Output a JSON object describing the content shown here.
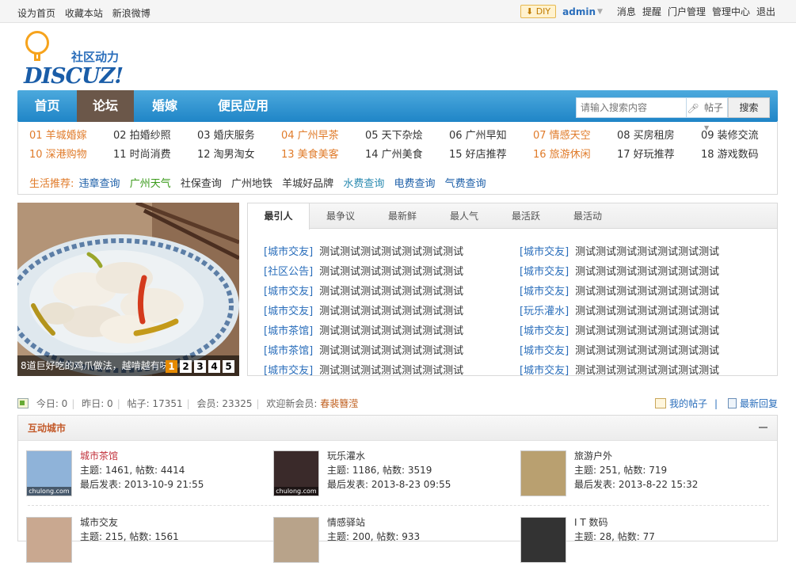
{
  "topbar": {
    "left": [
      "设为首页",
      "收藏本站",
      "新浪微博"
    ],
    "diy": "DIY",
    "user": "admin",
    "right": [
      "消息",
      "提醒",
      "门户管理",
      "管理中心",
      "退出"
    ]
  },
  "logo": {
    "tagline": "社区动力",
    "wordmark": "DISCUZ!"
  },
  "nav": {
    "items": [
      {
        "label": "首页",
        "active": false
      },
      {
        "label": "论坛",
        "active": true
      },
      {
        "label": "婚嫁",
        "active": false
      },
      {
        "label": "便民应用",
        "active": false
      }
    ],
    "search": {
      "placeholder": "请输入搜索内容",
      "type": "帖子",
      "button": "搜索"
    }
  },
  "categories": {
    "row1": [
      {
        "label": "01 羊城婚嫁",
        "highlight": true
      },
      {
        "label": "02 拍婚纱照",
        "highlight": false
      },
      {
        "label": "03 婚庆服务",
        "highlight": false
      },
      {
        "label": "04 广州早茶",
        "highlight": true
      },
      {
        "label": "05 天下杂烩",
        "highlight": false
      },
      {
        "label": "06 广州早知",
        "highlight": false
      },
      {
        "label": "07 情感天空",
        "highlight": true
      },
      {
        "label": "08 买房租房",
        "highlight": false
      },
      {
        "label": "09 装修交流",
        "highlight": false
      }
    ],
    "row2": [
      {
        "label": "10 深港购物",
        "highlight": true
      },
      {
        "label": "11 时尚消费",
        "highlight": false
      },
      {
        "label": "12 淘男淘女",
        "highlight": false
      },
      {
        "label": "13 美食美客",
        "highlight": true
      },
      {
        "label": "14 广州美食",
        "highlight": false
      },
      {
        "label": "15 好店推荐",
        "highlight": false
      },
      {
        "label": "16 旅游休闲",
        "highlight": true
      },
      {
        "label": "17 好玩推荐",
        "highlight": false
      },
      {
        "label": "18 游戏数码",
        "highlight": false
      }
    ],
    "life": {
      "label": "生活推荐:",
      "items": [
        "违章查询",
        "广州天气",
        "社保查询",
        "广州地铁",
        "羊城好品牌",
        "水费查询",
        "电费查询",
        "气费查询"
      ]
    }
  },
  "slide": {
    "caption": "8道巨好吃的鸡爪做法，越啃越有味",
    "pages": [
      "1",
      "2",
      "3",
      "4",
      "5"
    ],
    "active_page": 1
  },
  "tabs": {
    "items": [
      "最引人",
      "最争议",
      "最新鲜",
      "最人气",
      "最活跃",
      "最活动"
    ],
    "active": 0,
    "left": [
      {
        "cat": "[城市交友]",
        "title": "测试测试测试测试测试测试测试"
      },
      {
        "cat": "[社区公告]",
        "title": "测试测试测试测试测试测试测试"
      },
      {
        "cat": "[城市交友]",
        "title": "测试测试测试测试测试测试测试"
      },
      {
        "cat": "[城市交友]",
        "title": "测试测试测试测试测试测试测试"
      },
      {
        "cat": "[城市茶馆]",
        "title": "测试测试测试测试测试测试测试"
      },
      {
        "cat": "[城市茶馆]",
        "title": "测试测试测试测试测试测试测试"
      },
      {
        "cat": "[城市交友]",
        "title": "测试测试测试测试测试测试测试"
      }
    ],
    "right": [
      {
        "cat": "[城市交友]",
        "title": "测试测试测试测试测试测试测试"
      },
      {
        "cat": "[城市交友]",
        "title": "测试测试测试测试测试测试测试"
      },
      {
        "cat": "[城市交友]",
        "title": "测试测试测试测试测试测试测试"
      },
      {
        "cat": "[玩乐灌水]",
        "title": "测试测试测试测试测试测试测试"
      },
      {
        "cat": "[城市交友]",
        "title": "测试测试测试测试测试测试测试"
      },
      {
        "cat": "[城市交友]",
        "title": "测试测试测试测试测试测试测试"
      },
      {
        "cat": "[城市交友]",
        "title": "测试测试测试测试测试测试测试"
      }
    ]
  },
  "stats": {
    "today": "今日: 0",
    "yesterday": "昨日: 0",
    "posts": "帖子: 17351",
    "members": "会员: 23325",
    "welcome": "欢迎新会员:",
    "newest": "春裴簪滢",
    "my_posts": "我的帖子",
    "latest": "最新回复"
  },
  "forum": {
    "title": "互动城市",
    "items": [
      {
        "name": "城市茶馆",
        "topics": "主题: 1461, 帖数: 4414",
        "last": "最后发表: 2013-10-9 21:55",
        "hot": true,
        "thumb": "chulong.com",
        "bg": "#8fb3d9"
      },
      {
        "name": "玩乐灌水",
        "topics": "主题: 1186, 帖数: 3519",
        "last": "最后发表: 2013-8-23 09:55",
        "hot": false,
        "thumb": "chulong.com",
        "bg": "#3a2a2a"
      },
      {
        "name": "旅游户外",
        "topics": "主题: 251, 帖数: 719",
        "last": "最后发表: 2013-8-22 15:32",
        "hot": false,
        "thumb": "",
        "bg": "#b9a070"
      },
      {
        "name": "城市交友",
        "topics": "主题: 215, 帖数: 1561",
        "last": "",
        "hot": false,
        "thumb": "",
        "bg": "#c9a890"
      },
      {
        "name": "情感驿站",
        "topics": "主题: 200, 帖数: 933",
        "last": "",
        "hot": false,
        "thumb": "",
        "bg": "#b8a38a"
      },
      {
        "name": "I T 数码",
        "topics": "主题: 28, 帖数: 77",
        "last": "",
        "hot": false,
        "thumb": "",
        "bg": "#333333"
      }
    ]
  }
}
